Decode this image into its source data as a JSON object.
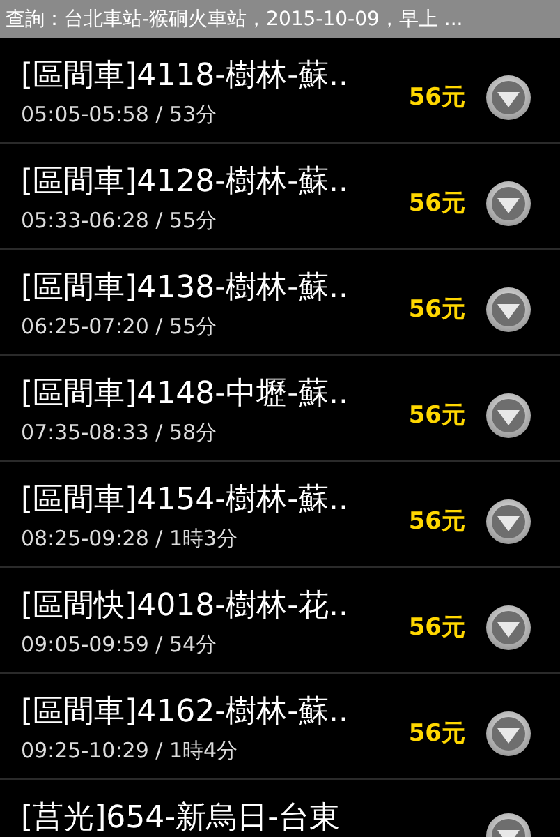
{
  "header": {
    "title": "查詢：台北車站-猴硐火車站，2015-10-09，早上 ..."
  },
  "trains": [
    {
      "title": "[區間車]4118-樹林-蘇..",
      "time": "05:05-05:58 / 53分",
      "price": "56元"
    },
    {
      "title": "[區間車]4128-樹林-蘇..",
      "time": "05:33-06:28 / 55分",
      "price": "56元"
    },
    {
      "title": "[區間車]4138-樹林-蘇..",
      "time": "06:25-07:20 / 55分",
      "price": "56元"
    },
    {
      "title": "[區間車]4148-中壢-蘇..",
      "time": "07:35-08:33 / 58分",
      "price": "56元"
    },
    {
      "title": "[區間車]4154-樹林-蘇..",
      "time": "08:25-09:28 / 1時3分",
      "price": "56元"
    },
    {
      "title": "[區間快]4018-樹林-花..",
      "time": "09:05-09:59 / 54分",
      "price": "56元"
    },
    {
      "title": "[區間車]4162-樹林-蘇..",
      "time": "09:25-10:29 / 1時4分",
      "price": "56元"
    },
    {
      "title": "[莒光]654-新烏日-台東"
    }
  ]
}
